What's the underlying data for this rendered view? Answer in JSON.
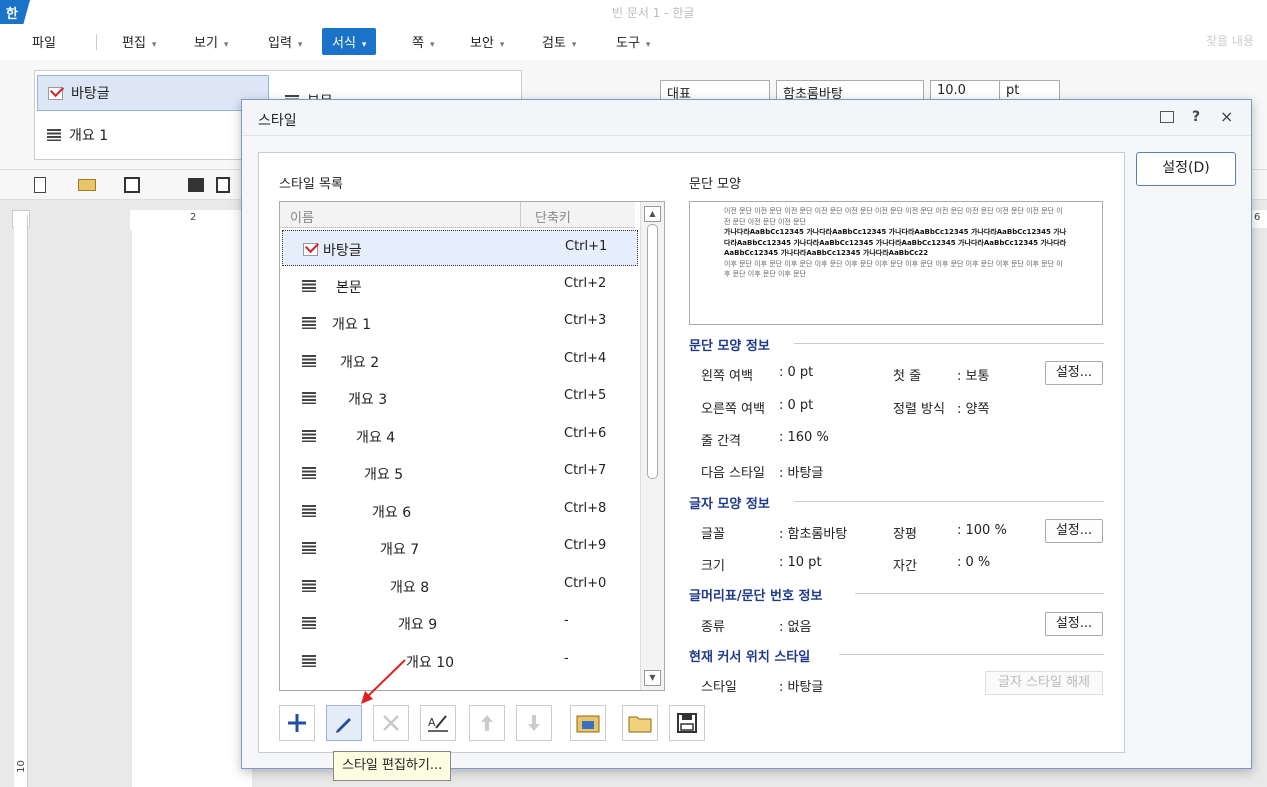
{
  "window": {
    "title": "빈 문서 1 - 한글",
    "app_logo": "한"
  },
  "menu": [
    {
      "label": "파일",
      "arrow": ""
    },
    {
      "label": "편집",
      "arrow": "▾"
    },
    {
      "label": "보기",
      "arrow": "▾"
    },
    {
      "label": "입력",
      "arrow": "▾"
    },
    {
      "label": "서식",
      "arrow": "▾"
    },
    {
      "label": "쪽",
      "arrow": "▾"
    },
    {
      "label": "보안",
      "arrow": "▾"
    },
    {
      "label": "검토",
      "arrow": "▾"
    },
    {
      "label": "도구",
      "arrow": "▾"
    }
  ],
  "find_text": "찾을 내용",
  "ribbon": {
    "style_items": [
      "바탕글",
      "개요 1",
      "본문"
    ],
    "combo_rep": "대표",
    "combo_font": "함초롬바탕",
    "combo_size": "10.0",
    "combo_unit": "pt"
  },
  "ruler_marks": [
    "2",
    "6",
    "10"
  ],
  "dialog": {
    "title": "스타일",
    "help": "?",
    "close": "×",
    "list_label": "스타일 목록",
    "col_name": "이름",
    "col_key": "단축키",
    "styles": [
      {
        "name": "바탕글",
        "key": "Ctrl+1"
      },
      {
        "name": "본문",
        "key": "Ctrl+2"
      },
      {
        "name": "개요 1",
        "key": "Ctrl+3"
      },
      {
        "name": "개요 2",
        "key": "Ctrl+4"
      },
      {
        "name": "개요 3",
        "key": "Ctrl+5"
      },
      {
        "name": "개요 4",
        "key": "Ctrl+6"
      },
      {
        "name": "개요 5",
        "key": "Ctrl+7"
      },
      {
        "name": "개요 6",
        "key": "Ctrl+8"
      },
      {
        "name": "개요 7",
        "key": "Ctrl+9"
      },
      {
        "name": "개요 8",
        "key": "Ctrl+0"
      },
      {
        "name": "개요 9",
        "key": "-"
      },
      {
        "name": "개요 10",
        "key": "-"
      }
    ],
    "para_label": "문단 모양",
    "preview": {
      "prev": "이전 문단 이전 문단 이전 문단 이전 문단 이전 문단 이전 문단 이전 문단 이전 문단 이전 문단 이전 문단 이전 문단 이전 문단 이전 문단 이전 문단",
      "body": "가나다라AaBbCc12345 가나다라AaBbCc12345 가나다라AaBbCc12345 가나다라AaBbCc12345 가나다라AaBbCc12345 가나다라AaBbCc12345 가나다라AaBbCc12345 가나다라AaBbCc12345 가나다라AaBbCc12345 가나다라AaBbCc12345 가나다라AaBbCc22",
      "next": "이후 문단 이후 문단 이후 문단 이후 문단 이후 문단 이후 문단 이후 문단 이후 문단 이후 문단 이후 문단 이후 문단 이후 문단 이후 문단 이후 문단"
    },
    "sec_para": "문단 모양 정보",
    "left_margin_k": "왼쪽 여백",
    "left_margin_v": ": 0 pt",
    "first_line_k": "첫 줄",
    "first_line_v": ": 보통",
    "right_margin_k": "오른쪽 여백",
    "right_margin_v": ": 0 pt",
    "align_k": "정렬 방식",
    "align_v": ": 양쪽",
    "line_k": "줄 간격",
    "line_v": ": 160 %",
    "next_k": "다음 스타일",
    "next_v": ": 바탕글",
    "sec_char": "글자 모양 정보",
    "font_k": "글꼴",
    "font_v": ": 함초롬바탕",
    "ratio_k": "장평",
    "ratio_v": ": 100 %",
    "size_k": "크기",
    "size_v": ": 10 pt",
    "spacing_k": "자간",
    "spacing_v": ": 0 %",
    "sec_bullet": "글머리표/문단 번호 정보",
    "kind_k": "종류",
    "kind_v": ": 없음",
    "sec_cursor": "현재 커서 위치 스타일",
    "cur_k": "스타일",
    "cur_v": ": 바탕글",
    "btn_settings": "설정...",
    "btn_release": "글자 스타일 해제",
    "btn_main": "설정(D)",
    "tooltip": "스타일 편집하기..."
  }
}
